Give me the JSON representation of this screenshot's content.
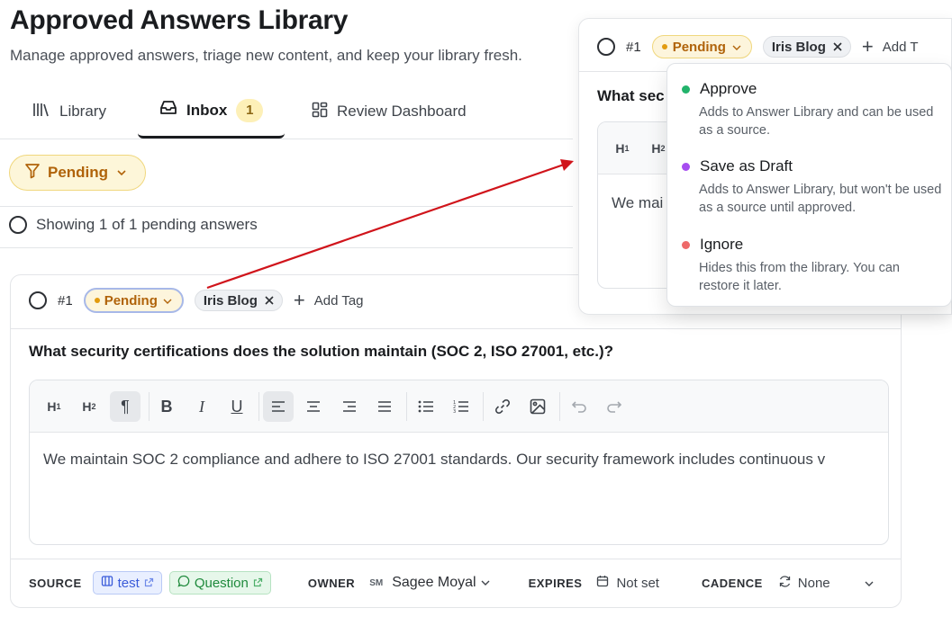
{
  "header": {
    "title": "Approved Answers Library",
    "subtitle": "Manage approved answers, triage new content, and keep your library fresh."
  },
  "tabs": [
    {
      "label": "Library",
      "icon": "library-icon"
    },
    {
      "label": "Inbox",
      "icon": "inbox-icon",
      "count": "1"
    },
    {
      "label": "Review Dashboard",
      "icon": "dashboard-icon"
    }
  ],
  "filter": {
    "label": "Pending",
    "icon": "filter-icon"
  },
  "list": {
    "showing_text": "Showing 1 of 1 pending answers"
  },
  "card": {
    "number": "#1",
    "status": "Pending",
    "tag": "Iris Blog",
    "add_tag_label": "Add Tag",
    "question": "What security certifications does the solution maintain (SOC 2, ISO 27001, etc.)?",
    "answer_text": "We maintain SOC 2 compliance and adhere to ISO 27001 standards. Our security framework includes continuous v",
    "toolbar": [
      "H1",
      "H2",
      "paragraph",
      "bold",
      "italic",
      "underline",
      "align-left",
      "align-center",
      "align-right",
      "align-justify",
      "bullet-list",
      "numbered-list",
      "link",
      "image",
      "undo",
      "redo"
    ],
    "footer": {
      "source_label": "SOURCE",
      "source_chips": [
        {
          "label": "test"
        },
        {
          "label": "Question"
        }
      ],
      "owner_label": "OWNER",
      "owner_initials": "SM",
      "owner_name": "Sagee Moyal",
      "expires_label": "EXPIRES",
      "expires_value": "Not set",
      "cadence_label": "CADENCE",
      "cadence_value": "None"
    }
  },
  "popup": {
    "number": "#1",
    "status": "Pending",
    "tag": "Iris Blog",
    "add_tag_label": "Add T",
    "question_partial": "What sec",
    "answer_partial": "We mai",
    "menu": [
      {
        "label": "Approve",
        "description": "Adds to Answer Library and can be used as a source.",
        "color": "#22b36b"
      },
      {
        "label": "Save as Draft",
        "description": "Adds to Answer Library, but won't be used as a source until approved.",
        "color": "#a64df0"
      },
      {
        "label": "Ignore",
        "description": "Hides this from the library. You can restore it later.",
        "color": "#ee6a6a"
      }
    ]
  },
  "colors": {
    "accent_arrow": "#d0141b",
    "pending": "#b0630a"
  }
}
